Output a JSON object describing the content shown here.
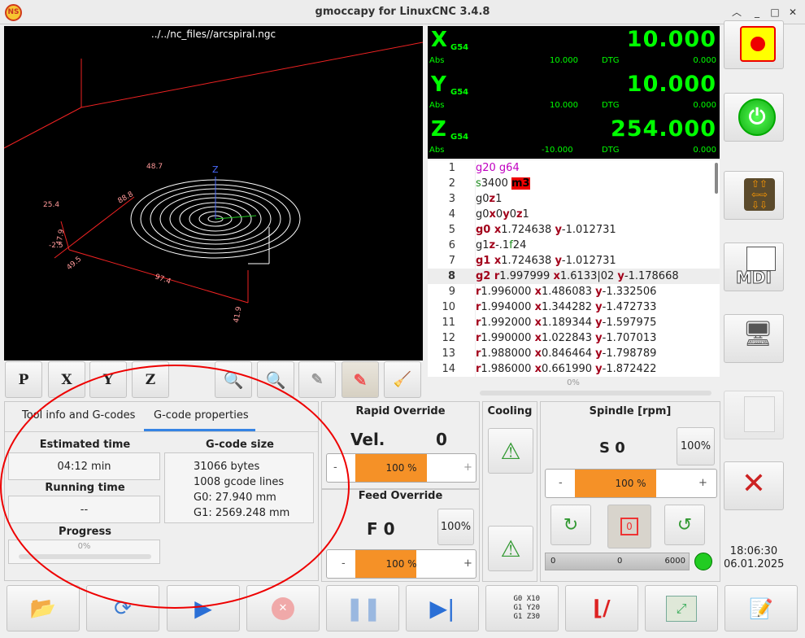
{
  "window": {
    "title": "gmoccapy for LinuxCNC  3.4.8",
    "logo": "NS"
  },
  "preview": {
    "filename": "../../nc_files//arcspiral.ngc",
    "axis_labels": {
      "z": "Z",
      "a": "25.4",
      "b": "47.9",
      "c": "-2.5",
      "d": "49.5",
      "e": "97.4",
      "f": "41.9",
      "g": "48.7",
      "h": "88.8"
    }
  },
  "view_buttons": [
    "P",
    "X",
    "Y",
    "Z"
  ],
  "dro": {
    "axes": [
      {
        "name": "X",
        "coord": "G54",
        "value": "10.000",
        "abs_label": "Abs",
        "abs": "10.000",
        "dtg_label": "DTG",
        "dtg": "0.000"
      },
      {
        "name": "Y",
        "coord": "G54",
        "value": "10.000",
        "abs_label": "Abs",
        "abs": "10.000",
        "dtg_label": "DTG",
        "dtg": "0.000"
      },
      {
        "name": "Z",
        "coord": "G54",
        "value": "254.000",
        "abs_label": "Abs",
        "abs": "-10.000",
        "dtg_label": "DTG",
        "dtg": "0.000"
      }
    ]
  },
  "gcode": {
    "lines": [
      {
        "n": "1"
      },
      {
        "n": "2"
      },
      {
        "n": "3"
      },
      {
        "n": "4"
      },
      {
        "n": "5"
      },
      {
        "n": "6"
      },
      {
        "n": "7"
      },
      {
        "n": "8"
      },
      {
        "n": "9"
      },
      {
        "n": "10"
      },
      {
        "n": "11"
      },
      {
        "n": "12"
      },
      {
        "n": "13"
      },
      {
        "n": "14"
      }
    ],
    "progress": "0%"
  },
  "right_buttons": {
    "mdi_label": "MDI"
  },
  "tabs": {
    "tab1": "Tool info and G-codes",
    "tab2": "G-code properties"
  },
  "props": {
    "estimated_label": "Estimated time",
    "estimated": "04:12 min",
    "running_label": "Running time",
    "running": "--",
    "progress_label": "Progress",
    "progress": "0%",
    "size_label": "G-code size",
    "size_lines": [
      "31066 bytes",
      "1008 gcode lines",
      "G0: 27.940 mm",
      "G1: 2569.248 mm"
    ]
  },
  "rapid": {
    "title": "Rapid Override",
    "vel_label": "Vel.",
    "vel": "0",
    "percent": "100 %",
    "fraction": 0.78,
    "minus": "-",
    "plus": "+"
  },
  "feed": {
    "title": "Feed Override",
    "label": "F  0",
    "reset": "100%",
    "percent": "100 %",
    "fraction": 0.66,
    "minus": "-",
    "plus": "+"
  },
  "cooling": {
    "title": "Cooling"
  },
  "spindle": {
    "title": "Spindle [rpm]",
    "s": "S 0",
    "reset": "100%",
    "percent": "100 %",
    "fraction": 0.73,
    "minus": "-",
    "plus": "+",
    "bar_min": "0",
    "bar_mid": "0",
    "bar_max": "6000",
    "stop_label": "0"
  },
  "clock": {
    "time": "18:06:30",
    "date": "06.01.2025"
  },
  "bottom": {
    "gcode_labels": [
      "G0  X10",
      "G1  Y20",
      "G1  Z30"
    ]
  }
}
